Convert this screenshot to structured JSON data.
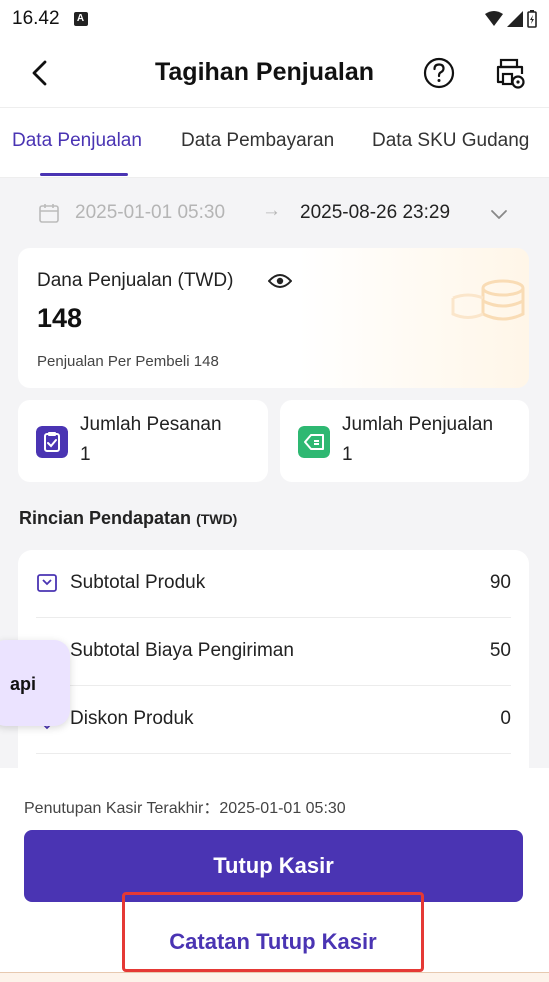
{
  "status_bar": {
    "time": "16.42",
    "sim_glyph": "A"
  },
  "header": {
    "title": "Tagihan Penjualan"
  },
  "tabs": [
    {
      "label": "Data Penjualan",
      "active": true
    },
    {
      "label": "Data Pembayaran",
      "active": false
    },
    {
      "label": "Data SKU Gudang",
      "active": false
    }
  ],
  "date_range": {
    "start": "2025-01-01 05:30",
    "arrow": "→",
    "end": "2025-08-26 23:29"
  },
  "sales_card": {
    "label": "Dana Penjualan (TWD)",
    "value": "148",
    "sub": "Penjualan Per Pembeli 148"
  },
  "stats": [
    {
      "label": "Jumlah Pesanan",
      "value": "1",
      "icon": "clipboard-icon",
      "color": "#4a34b3"
    },
    {
      "label": "Jumlah Penjualan",
      "value": "1",
      "icon": "tag-icon",
      "color": "#2eb872"
    }
  ],
  "section": {
    "title": "Rincian Pendapatan",
    "unit": "(TWD)"
  },
  "detail_rows": [
    {
      "label": "Subtotal Produk",
      "value": "90",
      "icon": "box-icon"
    },
    {
      "label": "Subtotal Biaya Pengiriman",
      "value": "50",
      "icon": "truck-icon"
    },
    {
      "label": "Diskon Produk",
      "value": "0",
      "icon": "discount-icon"
    }
  ],
  "floating": {
    "label": "api"
  },
  "footer": {
    "last_close": "Penutupan Kasir Terakhir：2025-01-01 05:30",
    "primary_button": "Tutup Kasir",
    "secondary_button": "Catatan Tutup Kasir"
  },
  "colors": {
    "accent": "#4a34b3",
    "highlight_border": "#e53935"
  }
}
